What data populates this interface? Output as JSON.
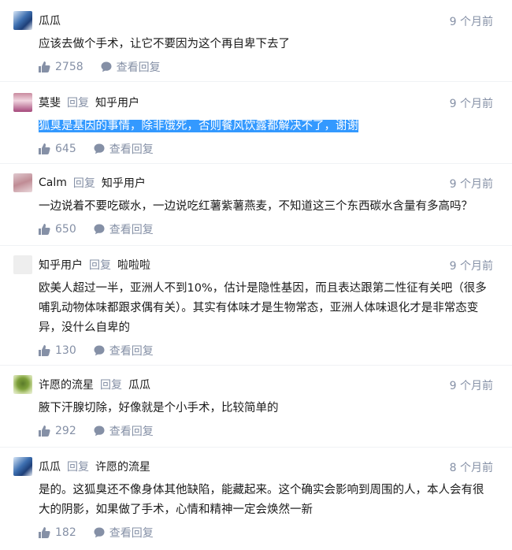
{
  "ui": {
    "reply_word": "回复",
    "view_reply": "查看回复"
  },
  "comments": [
    {
      "author": "瓜瓜",
      "reply_to": "",
      "time": "9 个月前",
      "text_before": "",
      "text_highlight": "",
      "text_after": "应该去做个手术，让它不要因为这个再自卑下去了",
      "likes": "2758",
      "avatar": "blue-swirl-avatar"
    },
    {
      "author": "莫斐",
      "reply_to": "知乎用户",
      "time": "9 个月前",
      "text_before": "",
      "text_highlight": "狐臭是基因的事情，除非饿死，否则餐风饮露都解决不了，谢谢",
      "text_after": "",
      "likes": "645",
      "avatar": "woman-pink-avatar"
    },
    {
      "author": "Calm",
      "reply_to": "知乎用户",
      "time": "9 个月前",
      "text_before": "",
      "text_highlight": "",
      "text_after": "一边说着不要吃碳水，一边说吃红薯紫薯燕麦，不知道这三个东西碳水含量有多高吗？",
      "likes": "650",
      "avatar": "pink-portrait-avatar"
    },
    {
      "author": "知乎用户",
      "reply_to": "啦啦啦",
      "time": "9 个月前",
      "text_before": "",
      "text_highlight": "",
      "text_after": "欧美人超过一半，亚洲人不到10%，估计是隐性基因，而且表达跟第二性征有关吧（很多哺乳动物体味都跟求偶有关）。其实有体味才是生物常态，亚洲人体味退化才是非常态变异，没什么自卑的",
      "likes": "130",
      "avatar": "default-user-avatar"
    },
    {
      "author": "许愿的流星",
      "reply_to": "瓜瓜",
      "time": "9 个月前",
      "text_before": "",
      "text_highlight": "",
      "text_after": "腋下汗腺切除，好像就是个小手术，比较简单的",
      "likes": "292",
      "avatar": "green-leaf-avatar"
    },
    {
      "author": "瓜瓜",
      "reply_to": "许愿的流星",
      "time": "8 个月前",
      "text_before": "",
      "text_highlight": "",
      "text_after": "是的。这狐臭还不像身体其他缺陷，能藏起来。这个确实会影响到周围的人，本人会有很大的阴影，如果做了手术，心情和精神一定会焕然一新",
      "likes": "182",
      "avatar": "blue-swirl-avatar"
    }
  ],
  "icons": {
    "like": "thumbs-up-icon",
    "reply": "speech-bubble-icon"
  },
  "colors": {
    "meta_gray": "#8590a6",
    "selection_blue": "#3399ff"
  }
}
